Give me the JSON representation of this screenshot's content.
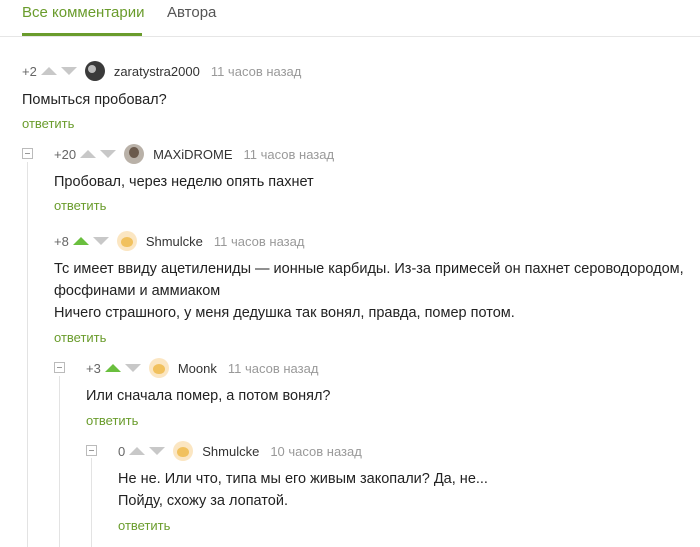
{
  "tabs": [
    {
      "label": "Все комментарии"
    },
    {
      "label": "Автора"
    }
  ],
  "comments": [
    {
      "rating": "+2",
      "author": "zaratystra2000",
      "time": "11 часов назад",
      "text": [
        "Помыться пробовал?"
      ],
      "reply": "ответить",
      "vote_up_active": false
    },
    {
      "rating": "+20",
      "author": "MAXiDROME",
      "time": "11 часов назад",
      "text": [
        "Пробовал, через неделю опять пахнет"
      ],
      "reply": "ответить",
      "vote_up_active": false
    },
    {
      "rating": "+8",
      "author": "Shmulcke",
      "time": "11 часов назад",
      "text": [
        "Тс имеет ввиду ацетилениды — ионные карбиды. Из-за примесей он пахнет сероводородом,",
        "фосфинами и аммиаком",
        "Ничего страшного, у меня дедушка так вонял, правда, помер потом."
      ],
      "reply": "ответить",
      "vote_up_active": true
    },
    {
      "rating": "+3",
      "author": "Moonk",
      "time": "11 часов назад",
      "text": [
        "Или сначала помер, а потом вонял?"
      ],
      "reply": "ответить",
      "vote_up_active": true
    },
    {
      "rating": "0",
      "author": "Shmulcke",
      "time": "10 часов назад",
      "text": [
        "Не не. Или что, типа мы его живым закопали? Да, не...",
        "Пойду, схожу за лопатой."
      ],
      "reply": "ответить",
      "vote_up_active": false
    }
  ],
  "colors": {
    "accent": "#6a9c2c",
    "vote_active": "#6abf3e",
    "vote_inactive": "#c8c8c8"
  },
  "icons": [
    "vote-up-icon",
    "vote-down-icon",
    "collapse-icon",
    "avatar"
  ]
}
